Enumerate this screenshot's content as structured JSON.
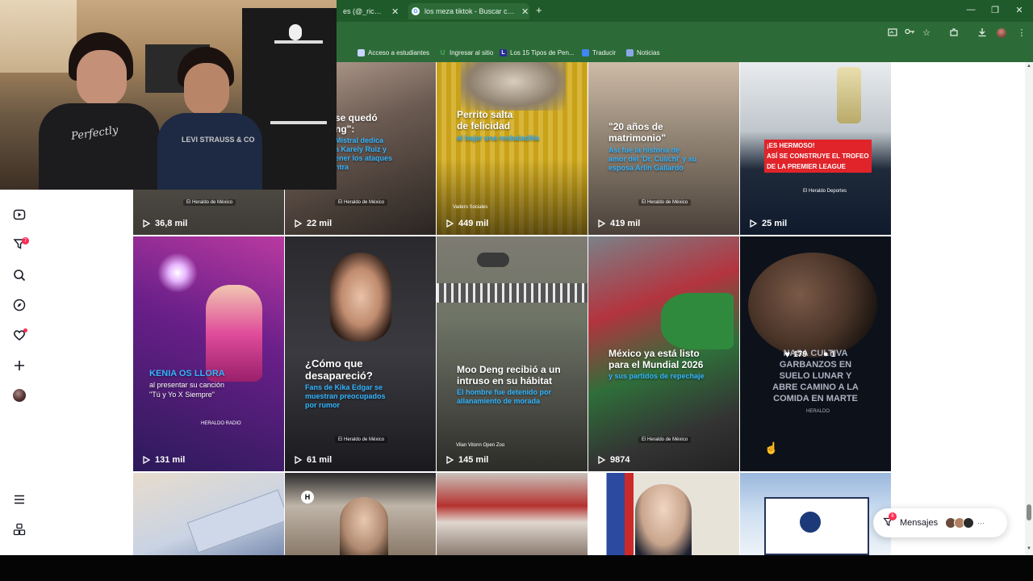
{
  "browser": {
    "tabs": [
      {
        "label": "es (@_ricardoang",
        "close": "✕"
      },
      {
        "label": "los meza tiktok - Buscar con Go",
        "close": "✕"
      }
    ],
    "new_tab": "+",
    "window_controls": [
      "—",
      "❐",
      "✕"
    ],
    "bookmarks": [
      {
        "label": "Acceso a estudiantes",
        "icon": "doc-icon",
        "color": "#c9d4ff"
      },
      {
        "label": "Ingresar al sitio",
        "icon": "u-icon",
        "color": "#4caf50"
      },
      {
        "label": "Los 15 Tipos de Pen...",
        "icon": "l-icon",
        "color": "#2a2a9a"
      },
      {
        "label": "Traducir",
        "icon": "translate-icon",
        "color": "#4285f4"
      },
      {
        "label": "Noticias",
        "icon": "news-icon",
        "color": "#4285f4"
      }
    ]
  },
  "sidebar": {
    "badge_count": "7"
  },
  "grid": {
    "tiles": [
      {
        "views": "36,8 mil",
        "logo": "El Heraldo de México"
      },
      {
        "headline": "se quedó\nng\":",
        "sub": "Mistral dedica\na Karely Ruiz y\nener los ataques\nntra",
        "views": "22 mil",
        "logo": "El Heraldo de México"
      },
      {
        "headline": "Perrito salta\nde felicidad",
        "sub": "al bajar una resbaladilla",
        "views": "449 mil",
        "logo": "Vadero Sociales"
      },
      {
        "headline": "\"20 años de\nmatrimonio\"",
        "sub": "Así fue la historia de\namor del 'Dr. Culichi' y su\nesposa Arlin Gallardo",
        "views": "419 mil",
        "logo": "El Heraldo de México"
      },
      {
        "headline": "¡ES HERMOSO!\nASÍ SE CONSTRUYE EL TROFEO\nDE LA PREMIER LEAGUE",
        "views": "25 mil",
        "logo": "El Heraldo Deportes"
      },
      {
        "headline": "KENIA OS LLORA",
        "sub": "al presentar su canción\n\"Tú y Yo X Siempre\"",
        "views": "131 mil",
        "logo": "HERALDO RADIO"
      },
      {
        "headline": "¿Cómo que\ndesapareció?",
        "sub": "Fans de Kika Edgar se\nmuestran preocupados\npor rumor",
        "views": "61 mil",
        "logo": "El Heraldo de México"
      },
      {
        "headline": "Moo Deng recibió a un\nintruso en su hábitat",
        "sub": "El hombre fue detenido por\nallanamiento de morada",
        "views": "145 mil",
        "logo": "Vilan Vitonn Open Zoo"
      },
      {
        "headline": "México ya está listo\npara el Mundial 2026",
        "sub": "y sus partidos de repechaje",
        "views": "9874",
        "logo": "El Heraldo de México"
      },
      {
        "headline": "NASA CULTIVA\nGARBANZOS EN\nSUELO LUNAR Y\nABRE CAMINO A LA\nCOMIDA EN MARTE",
        "likes": "179",
        "comments": "1",
        "logo": "HERALDO"
      }
    ]
  },
  "messages": {
    "label": "Mensajes",
    "badge": "6"
  }
}
